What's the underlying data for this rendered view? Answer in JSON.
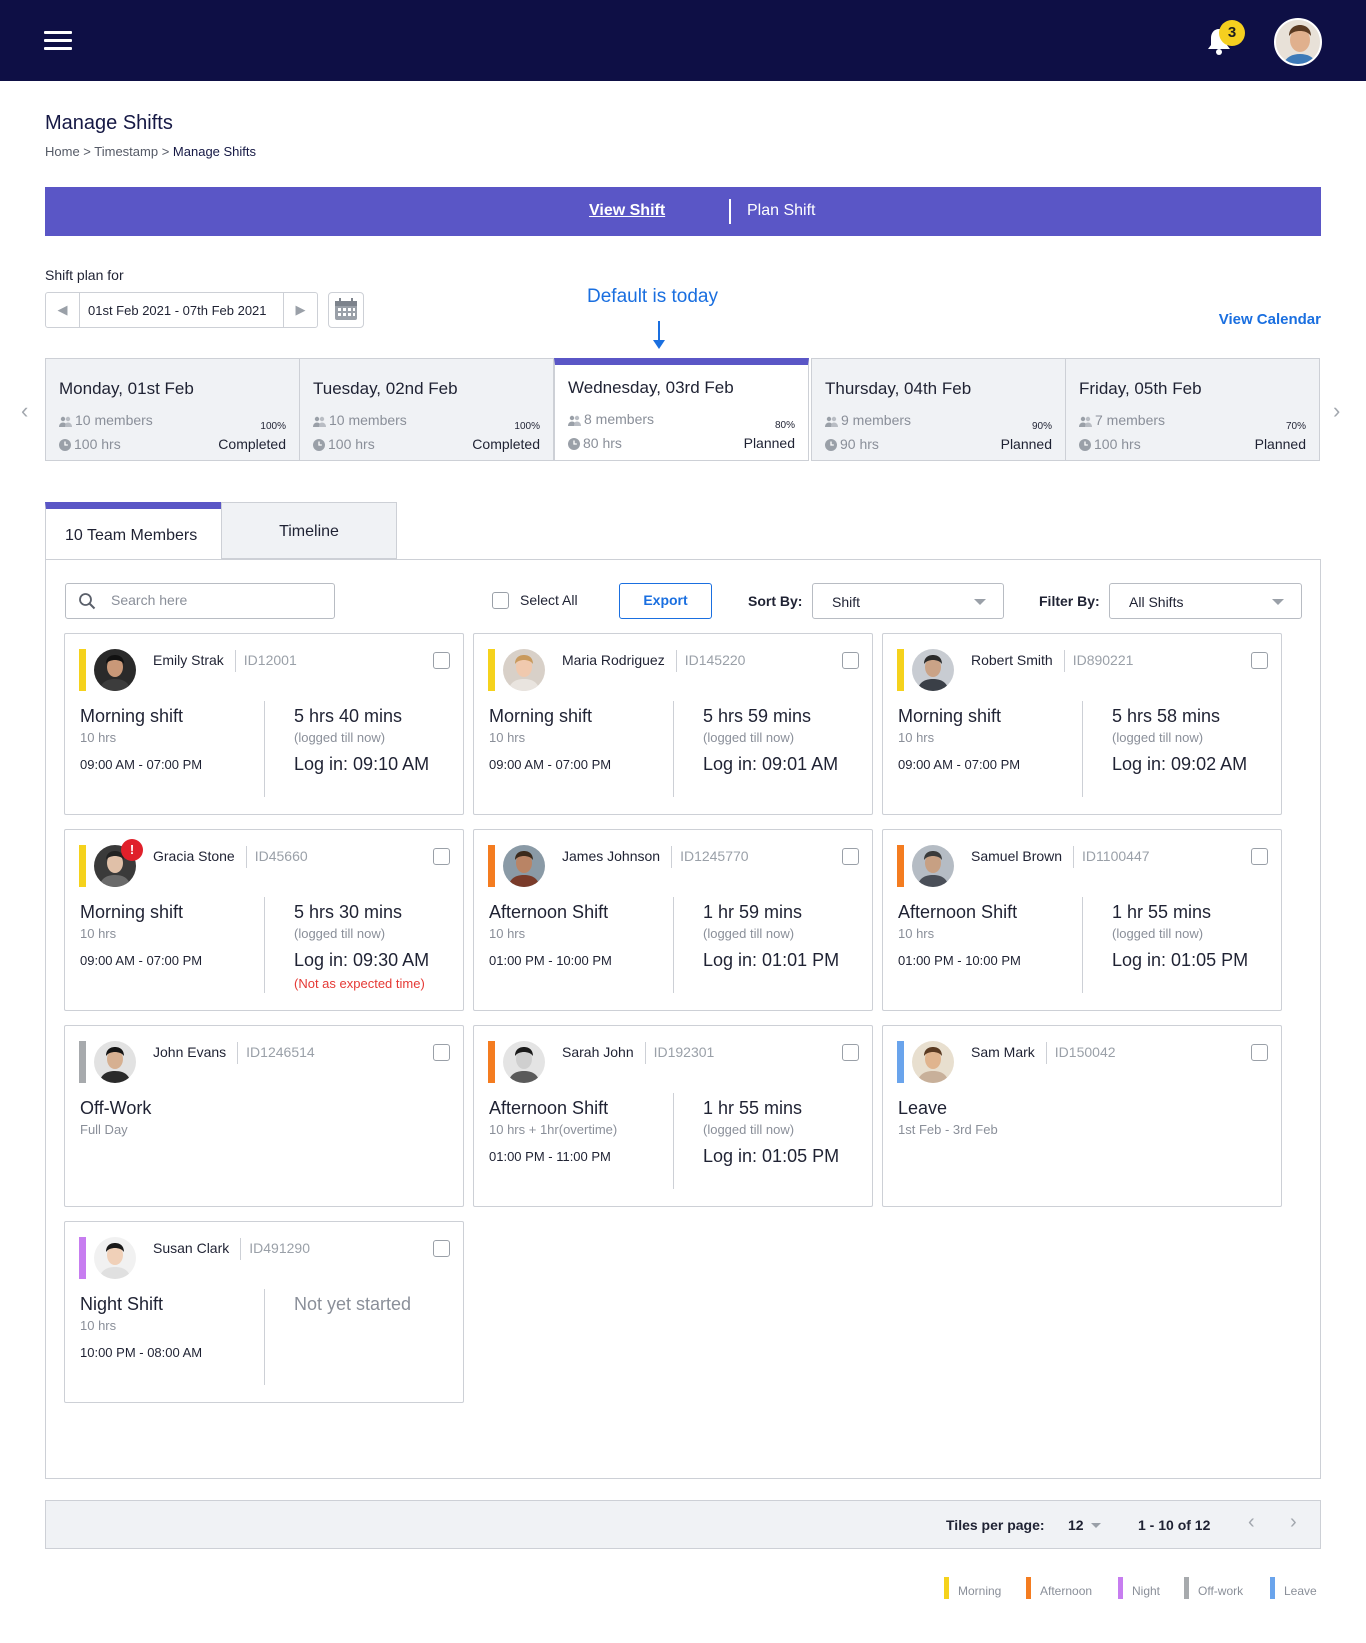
{
  "header": {
    "notification_count": "3"
  },
  "page": {
    "title": "Manage Shifts",
    "breadcrumb": {
      "home": "Home",
      "sep1": " > ",
      "section": "Timestamp",
      "sep2": " > ",
      "current": "Manage Shifts"
    }
  },
  "view_tabs": {
    "view": "View Shift",
    "plan": "Plan Shift"
  },
  "shift_plan": {
    "label": "Shift plan for",
    "date_range": "01st Feb 2021 - 07th Feb 2021",
    "annotation": "Default is today",
    "view_calendar": "View Calendar"
  },
  "days": [
    {
      "title": "Monday, 01st Feb",
      "members": "10 members",
      "hours": "100 hrs",
      "percent": "100%",
      "status": "Completed"
    },
    {
      "title": "Tuesday, 02nd Feb",
      "members": "10 members",
      "hours": "100 hrs",
      "percent": "100%",
      "status": "Completed"
    },
    {
      "title": "Wednesday, 03rd Feb",
      "members": "8 members",
      "hours": "80 hrs",
      "percent": "80%",
      "status": "Planned"
    },
    {
      "title": "Thursday, 04th Feb",
      "members": "9 members",
      "hours": "90 hrs",
      "percent": "90%",
      "status": "Planned"
    },
    {
      "title": "Friday, 05th Feb",
      "members": "7 members",
      "hours": "100 hrs",
      "percent": "70%",
      "status": "Planned"
    }
  ],
  "active_day_index": 2,
  "list_tabs": {
    "members": "10 Team Members",
    "timeline": "Timeline"
  },
  "toolbar": {
    "search_placeholder": "Search here",
    "select_all": "Select All",
    "export": "Export",
    "sort_label": "Sort By:",
    "sort_value": "Shift",
    "filter_label": "Filter By:",
    "filter_value": "All Shifts"
  },
  "colors": {
    "morning": "#f5d21c",
    "afternoon": "#f47c20",
    "night": "#c77df0",
    "offwork": "#a7aaad",
    "leave": "#6aa4ec",
    "accent": "#5a56c6",
    "link": "#1a6fe0",
    "header_bg": "#0e0f45"
  },
  "members": [
    {
      "name": "Emily Strak",
      "id": "ID12001",
      "type": "morning",
      "shift": "Morning shift",
      "duration": "10 hrs",
      "time": "09:00 AM - 07:00 PM",
      "logged": "5 hrs 40 mins",
      "logged_sub": "(logged till now)",
      "login": "Log in: 09:10 AM"
    },
    {
      "name": "Maria Rodriguez",
      "id": "ID145220",
      "type": "morning",
      "shift": "Morning shift",
      "duration": "10 hrs",
      "time": "09:00 AM - 07:00 PM",
      "logged": "5 hrs 59 mins",
      "logged_sub": "(logged till now)",
      "login": "Log in: 09:01 AM"
    },
    {
      "name": "Robert Smith",
      "id": "ID890221",
      "type": "morning",
      "shift": "Morning shift",
      "duration": "10 hrs",
      "time": "09:00 AM - 07:00 PM",
      "logged": "5 hrs 58 mins",
      "logged_sub": "(logged till now)",
      "login": "Log in: 09:02 AM"
    },
    {
      "name": "Gracia Stone",
      "id": "ID45660",
      "type": "morning",
      "shift": "Morning shift",
      "duration": "10 hrs",
      "time": "09:00 AM - 07:00 PM",
      "logged": "5 hrs 30 mins",
      "logged_sub": "(logged till now)",
      "login": "Log in: 09:30 AM",
      "warning": "(Not as expected time)",
      "alert": "!"
    },
    {
      "name": "James Johnson",
      "id": "ID1245770",
      "type": "afternoon",
      "shift": "Afternoon Shift",
      "duration": "10 hrs",
      "time": "01:00 PM - 10:00 PM",
      "logged": "1 hr 59 mins",
      "logged_sub": "(logged till now)",
      "login": "Log in: 01:01 PM"
    },
    {
      "name": "Samuel Brown",
      "id": "ID1100447",
      "type": "afternoon",
      "shift": "Afternoon Shift",
      "duration": "10 hrs",
      "time": "01:00 PM - 10:00 PM",
      "logged": "1 hr 55 mins",
      "logged_sub": "(logged till now)",
      "login": "Log in: 01:05 PM"
    },
    {
      "name": "John Evans",
      "id": "ID1246514",
      "type": "offwork",
      "shift": "Off-Work",
      "duration": "Full Day"
    },
    {
      "name": "Sarah John",
      "id": "ID192301",
      "type": "afternoon",
      "shift": "Afternoon Shift",
      "duration": "10 hrs + 1hr(overtime)",
      "time": "01:00 PM - 11:00 PM",
      "logged": "1 hr 55 mins",
      "logged_sub": "(logged till now)",
      "login": "Log in: 01:05 PM"
    },
    {
      "name": "Sam Mark",
      "id": "ID150042",
      "type": "leave",
      "shift": "Leave",
      "duration": "1st Feb - 3rd Feb"
    },
    {
      "name": "Susan Clark",
      "id": "ID491290",
      "type": "night",
      "shift": "Night Shift",
      "duration": "10 hrs",
      "time": "10:00 PM - 08:00 AM",
      "not_started": "Not yet started"
    }
  ],
  "pagination": {
    "tiles_label": "Tiles per page:",
    "tiles_value": "12",
    "range": "1 - 10 of 12"
  },
  "legend": [
    {
      "label": "Morning",
      "type": "morning"
    },
    {
      "label": "Afternoon",
      "type": "afternoon"
    },
    {
      "label": "Night",
      "type": "night"
    },
    {
      "label": "Off-work",
      "type": "offwork"
    },
    {
      "label": "Leave",
      "type": "leave"
    }
  ]
}
